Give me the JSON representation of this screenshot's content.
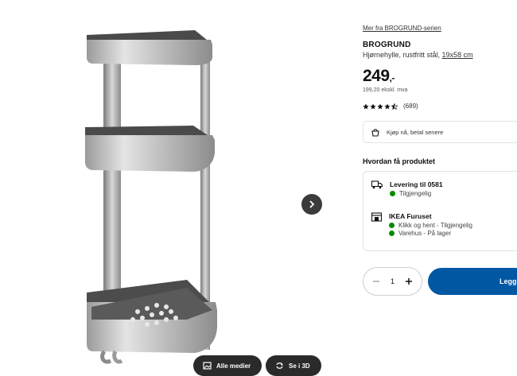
{
  "product": {
    "series_link": "Mer fra BROGRUND-serien",
    "name": "BROGRUND",
    "description": "Hjørnehylle, rustfritt stål,",
    "size": "19x58 cm",
    "price": "249",
    "price_suffix": ",-",
    "price_ex_vat": "199,20 ekskl. mva",
    "rating": {
      "stars": 4.5,
      "count": "(689)"
    }
  },
  "klarna": {
    "label": "Kjøp nå, betal senere",
    "icon": "klarna-logo-icon"
  },
  "delivery": {
    "heading": "Hvordan få produktet",
    "options": [
      {
        "icon": "truck-icon",
        "title": "Levering til 0581",
        "statuses": [
          "Tilgjengelig"
        ]
      },
      {
        "icon": "store-icon",
        "title": "IKEA Furuset",
        "statuses": [
          "Klikk og hent - Tilgjengelig",
          "Varehus - På lager"
        ]
      }
    ]
  },
  "purchase": {
    "quantity": "1",
    "add_label": "Legg"
  },
  "gallery": {
    "all_media_label": "Alle medier",
    "view_3d_label": "Se i 3D",
    "next_icon": "chevron-right-icon"
  },
  "colors": {
    "accent": "#0058a3",
    "available": "#0a8a00",
    "dark_button": "#2a2a2a"
  }
}
